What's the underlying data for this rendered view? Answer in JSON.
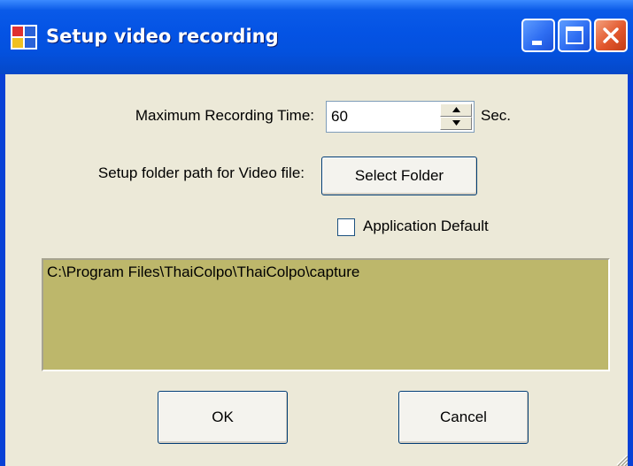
{
  "window": {
    "title": "Setup video recording",
    "controls": [
      "minimize-icon",
      "maximize-icon",
      "close-icon"
    ]
  },
  "form": {
    "max_time_label": "Maximum Recording Time:",
    "max_time_value": "60",
    "max_time_unit": "Sec.",
    "folder_label": "Setup folder path for Video file:",
    "select_folder_label": "Select Folder",
    "app_default_label": "Application Default",
    "app_default_checked": false,
    "folder_path": "C:\\Program Files\\ThaiColpo\\ThaiColpo\\capture"
  },
  "buttons": {
    "ok_label": "OK",
    "cancel_label": "Cancel"
  },
  "colors": {
    "titlebar": "#0453e4",
    "client_background": "#ece9d8",
    "path_box_background": "#bdb76b",
    "close_button": "#e2572c"
  }
}
